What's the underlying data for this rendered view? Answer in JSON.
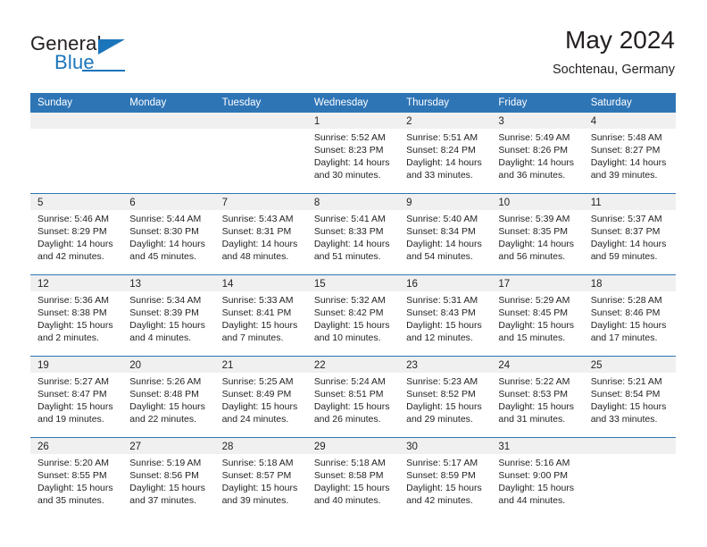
{
  "logo": {
    "word_top": "General",
    "word_bottom": "Blue",
    "triangle_icon": "triangle-icon",
    "accent_color": "#1b75bb"
  },
  "header": {
    "title": "May 2024",
    "subtitle": "Sochtenau, Germany"
  },
  "theme": {
    "header_blue": "#2e75b6",
    "day_band_grey": "#f0f0f0",
    "text": "#231f20"
  },
  "weekdays": [
    "Sunday",
    "Monday",
    "Tuesday",
    "Wednesday",
    "Thursday",
    "Friday",
    "Saturday"
  ],
  "weeks": [
    [
      {
        "day": "",
        "empty": true,
        "sunrise": "",
        "sunset": "",
        "daylight1": "",
        "daylight2": ""
      },
      {
        "day": "",
        "empty": true,
        "sunrise": "",
        "sunset": "",
        "daylight1": "",
        "daylight2": ""
      },
      {
        "day": "",
        "empty": true,
        "sunrise": "",
        "sunset": "",
        "daylight1": "",
        "daylight2": ""
      },
      {
        "day": "1",
        "empty": false,
        "sunrise": "Sunrise: 5:52 AM",
        "sunset": "Sunset: 8:23 PM",
        "daylight1": "Daylight: 14 hours",
        "daylight2": "and 30 minutes."
      },
      {
        "day": "2",
        "empty": false,
        "sunrise": "Sunrise: 5:51 AM",
        "sunset": "Sunset: 8:24 PM",
        "daylight1": "Daylight: 14 hours",
        "daylight2": "and 33 minutes."
      },
      {
        "day": "3",
        "empty": false,
        "sunrise": "Sunrise: 5:49 AM",
        "sunset": "Sunset: 8:26 PM",
        "daylight1": "Daylight: 14 hours",
        "daylight2": "and 36 minutes."
      },
      {
        "day": "4",
        "empty": false,
        "sunrise": "Sunrise: 5:48 AM",
        "sunset": "Sunset: 8:27 PM",
        "daylight1": "Daylight: 14 hours",
        "daylight2": "and 39 minutes."
      }
    ],
    [
      {
        "day": "5",
        "empty": false,
        "sunrise": "Sunrise: 5:46 AM",
        "sunset": "Sunset: 8:29 PM",
        "daylight1": "Daylight: 14 hours",
        "daylight2": "and 42 minutes."
      },
      {
        "day": "6",
        "empty": false,
        "sunrise": "Sunrise: 5:44 AM",
        "sunset": "Sunset: 8:30 PM",
        "daylight1": "Daylight: 14 hours",
        "daylight2": "and 45 minutes."
      },
      {
        "day": "7",
        "empty": false,
        "sunrise": "Sunrise: 5:43 AM",
        "sunset": "Sunset: 8:31 PM",
        "daylight1": "Daylight: 14 hours",
        "daylight2": "and 48 minutes."
      },
      {
        "day": "8",
        "empty": false,
        "sunrise": "Sunrise: 5:41 AM",
        "sunset": "Sunset: 8:33 PM",
        "daylight1": "Daylight: 14 hours",
        "daylight2": "and 51 minutes."
      },
      {
        "day": "9",
        "empty": false,
        "sunrise": "Sunrise: 5:40 AM",
        "sunset": "Sunset: 8:34 PM",
        "daylight1": "Daylight: 14 hours",
        "daylight2": "and 54 minutes."
      },
      {
        "day": "10",
        "empty": false,
        "sunrise": "Sunrise: 5:39 AM",
        "sunset": "Sunset: 8:35 PM",
        "daylight1": "Daylight: 14 hours",
        "daylight2": "and 56 minutes."
      },
      {
        "day": "11",
        "empty": false,
        "sunrise": "Sunrise: 5:37 AM",
        "sunset": "Sunset: 8:37 PM",
        "daylight1": "Daylight: 14 hours",
        "daylight2": "and 59 minutes."
      }
    ],
    [
      {
        "day": "12",
        "empty": false,
        "sunrise": "Sunrise: 5:36 AM",
        "sunset": "Sunset: 8:38 PM",
        "daylight1": "Daylight: 15 hours",
        "daylight2": "and 2 minutes."
      },
      {
        "day": "13",
        "empty": false,
        "sunrise": "Sunrise: 5:34 AM",
        "sunset": "Sunset: 8:39 PM",
        "daylight1": "Daylight: 15 hours",
        "daylight2": "and 4 minutes."
      },
      {
        "day": "14",
        "empty": false,
        "sunrise": "Sunrise: 5:33 AM",
        "sunset": "Sunset: 8:41 PM",
        "daylight1": "Daylight: 15 hours",
        "daylight2": "and 7 minutes."
      },
      {
        "day": "15",
        "empty": false,
        "sunrise": "Sunrise: 5:32 AM",
        "sunset": "Sunset: 8:42 PM",
        "daylight1": "Daylight: 15 hours",
        "daylight2": "and 10 minutes."
      },
      {
        "day": "16",
        "empty": false,
        "sunrise": "Sunrise: 5:31 AM",
        "sunset": "Sunset: 8:43 PM",
        "daylight1": "Daylight: 15 hours",
        "daylight2": "and 12 minutes."
      },
      {
        "day": "17",
        "empty": false,
        "sunrise": "Sunrise: 5:29 AM",
        "sunset": "Sunset: 8:45 PM",
        "daylight1": "Daylight: 15 hours",
        "daylight2": "and 15 minutes."
      },
      {
        "day": "18",
        "empty": false,
        "sunrise": "Sunrise: 5:28 AM",
        "sunset": "Sunset: 8:46 PM",
        "daylight1": "Daylight: 15 hours",
        "daylight2": "and 17 minutes."
      }
    ],
    [
      {
        "day": "19",
        "empty": false,
        "sunrise": "Sunrise: 5:27 AM",
        "sunset": "Sunset: 8:47 PM",
        "daylight1": "Daylight: 15 hours",
        "daylight2": "and 19 minutes."
      },
      {
        "day": "20",
        "empty": false,
        "sunrise": "Sunrise: 5:26 AM",
        "sunset": "Sunset: 8:48 PM",
        "daylight1": "Daylight: 15 hours",
        "daylight2": "and 22 minutes."
      },
      {
        "day": "21",
        "empty": false,
        "sunrise": "Sunrise: 5:25 AM",
        "sunset": "Sunset: 8:49 PM",
        "daylight1": "Daylight: 15 hours",
        "daylight2": "and 24 minutes."
      },
      {
        "day": "22",
        "empty": false,
        "sunrise": "Sunrise: 5:24 AM",
        "sunset": "Sunset: 8:51 PM",
        "daylight1": "Daylight: 15 hours",
        "daylight2": "and 26 minutes."
      },
      {
        "day": "23",
        "empty": false,
        "sunrise": "Sunrise: 5:23 AM",
        "sunset": "Sunset: 8:52 PM",
        "daylight1": "Daylight: 15 hours",
        "daylight2": "and 29 minutes."
      },
      {
        "day": "24",
        "empty": false,
        "sunrise": "Sunrise: 5:22 AM",
        "sunset": "Sunset: 8:53 PM",
        "daylight1": "Daylight: 15 hours",
        "daylight2": "and 31 minutes."
      },
      {
        "day": "25",
        "empty": false,
        "sunrise": "Sunrise: 5:21 AM",
        "sunset": "Sunset: 8:54 PM",
        "daylight1": "Daylight: 15 hours",
        "daylight2": "and 33 minutes."
      }
    ],
    [
      {
        "day": "26",
        "empty": false,
        "sunrise": "Sunrise: 5:20 AM",
        "sunset": "Sunset: 8:55 PM",
        "daylight1": "Daylight: 15 hours",
        "daylight2": "and 35 minutes."
      },
      {
        "day": "27",
        "empty": false,
        "sunrise": "Sunrise: 5:19 AM",
        "sunset": "Sunset: 8:56 PM",
        "daylight1": "Daylight: 15 hours",
        "daylight2": "and 37 minutes."
      },
      {
        "day": "28",
        "empty": false,
        "sunrise": "Sunrise: 5:18 AM",
        "sunset": "Sunset: 8:57 PM",
        "daylight1": "Daylight: 15 hours",
        "daylight2": "and 39 minutes."
      },
      {
        "day": "29",
        "empty": false,
        "sunrise": "Sunrise: 5:18 AM",
        "sunset": "Sunset: 8:58 PM",
        "daylight1": "Daylight: 15 hours",
        "daylight2": "and 40 minutes."
      },
      {
        "day": "30",
        "empty": false,
        "sunrise": "Sunrise: 5:17 AM",
        "sunset": "Sunset: 8:59 PM",
        "daylight1": "Daylight: 15 hours",
        "daylight2": "and 42 minutes."
      },
      {
        "day": "31",
        "empty": false,
        "sunrise": "Sunrise: 5:16 AM",
        "sunset": "Sunset: 9:00 PM",
        "daylight1": "Daylight: 15 hours",
        "daylight2": "and 44 minutes."
      },
      {
        "day": "",
        "empty": true,
        "sunrise": "",
        "sunset": "",
        "daylight1": "",
        "daylight2": ""
      }
    ]
  ]
}
